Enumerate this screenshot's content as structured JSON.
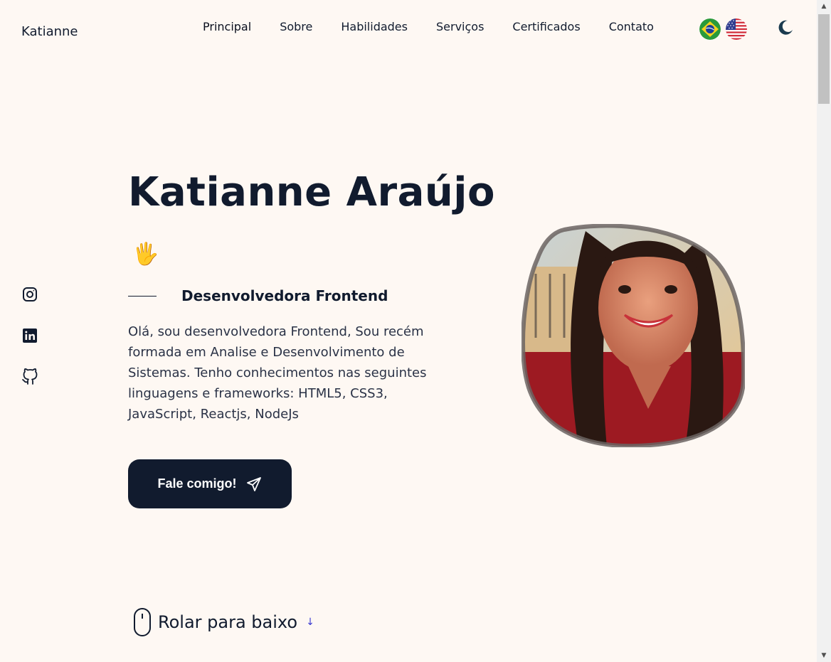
{
  "header": {
    "logo": "Katianne",
    "nav": [
      "Principal",
      "Sobre",
      "Habilidades",
      "Serviços",
      "Certificados",
      "Contato"
    ],
    "flags": [
      "brazil-flag-icon",
      "usa-flag-icon"
    ],
    "theme_icon": "moon-icon"
  },
  "social": [
    "instagram-icon",
    "linkedin-icon",
    "github-icon"
  ],
  "hero": {
    "title": "Katianne Araújo",
    "wave_emoji": "🖐",
    "subtitle": "Desenvolvedora Frontend",
    "description": "Olá, sou desenvolvedora Frontend, Sou recém formada em Analise e Desenvolvimento de Sistemas. Tenho conhecimentos nas seguintes linguagens e frameworks: HTML5, CSS3, JavaScript, Reactjs, NodeJs",
    "cta_label": "Fale comigo!",
    "cta_icon": "send-icon"
  },
  "scroll_hint": {
    "label": "Rolar para baixo",
    "arrow": "↓",
    "icon": "mouse-icon"
  },
  "colors": {
    "background": "#fef8f3",
    "text": "#111b2e",
    "button_bg": "#111b2e",
    "accent": "#3b3bd1"
  }
}
